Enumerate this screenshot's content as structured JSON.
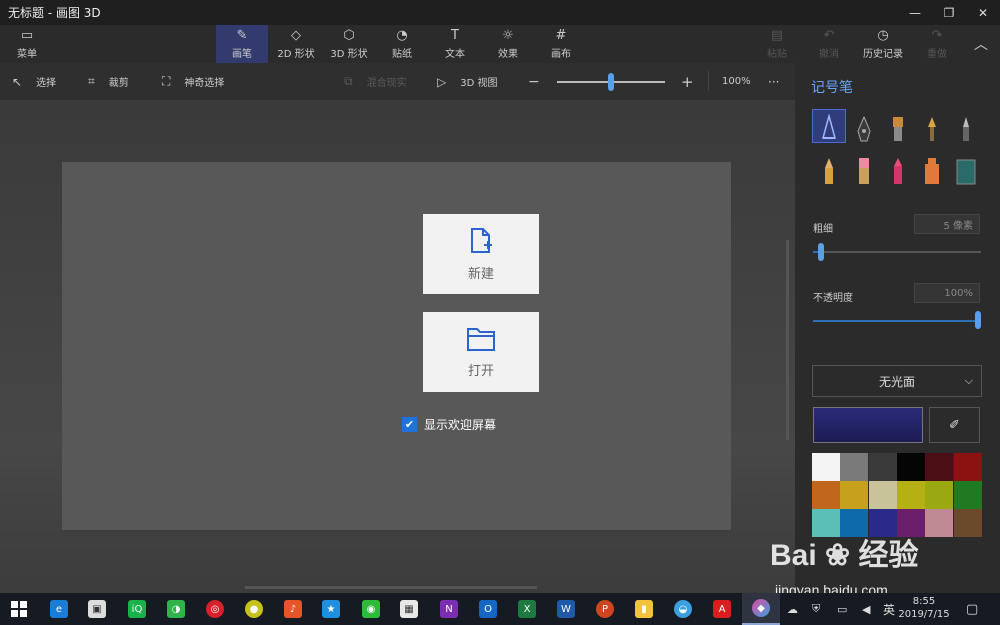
{
  "window": {
    "title": "无标题 - 画图 3D",
    "controls": [
      "—",
      "❐",
      "✕"
    ]
  },
  "ribbon": {
    "menu": "菜单",
    "tabs": [
      {
        "label": "画笔",
        "icon": "brush-icon",
        "glyph": "✎"
      },
      {
        "label": "2D 形状",
        "icon": "shapes-2d-icon",
        "glyph": "◇"
      },
      {
        "label": "3D 形状",
        "icon": "cube-icon",
        "glyph": "⬡"
      },
      {
        "label": "贴纸",
        "icon": "sticker-icon",
        "glyph": "◔"
      },
      {
        "label": "文本",
        "icon": "text-icon",
        "glyph": "T"
      },
      {
        "label": "效果",
        "icon": "effects-icon",
        "glyph": "☼"
      },
      {
        "label": "画布",
        "icon": "canvas-icon",
        "glyph": "#"
      }
    ],
    "right": [
      {
        "label": "粘贴",
        "icon": "paste-icon",
        "glyph": "▤"
      },
      {
        "label": "撤消",
        "icon": "undo-icon",
        "glyph": "↶"
      },
      {
        "label": "历史记录",
        "icon": "history-icon",
        "glyph": "◷"
      },
      {
        "label": "重做",
        "icon": "redo-icon",
        "glyph": "↷"
      }
    ]
  },
  "toolbar": {
    "select": "选择",
    "crop": "裁剪",
    "magic_select": "神奇选择",
    "mixed_reality": "混合现实",
    "view_3d": "3D 视图",
    "zoom": "100%",
    "zoom_level": 0.5,
    "more": "···"
  },
  "welcome": {
    "new_label": "新建",
    "open_label": "打开",
    "show_welcome": "显示欢迎屏幕",
    "checked": true
  },
  "panel": {
    "title": "记号笔",
    "thickness_label": "粗细",
    "thickness_value": "5 像素",
    "thickness_level": 0.05,
    "opacity_label": "不透明度",
    "opacity_value": "100%",
    "opacity_level": 1.0,
    "finish": "无光面",
    "current_color": "#2b2a7a",
    "swatches": [
      "#f4f4f4",
      "#7a7a7a",
      "#3a3a3a",
      "#050505",
      "#4a0e14",
      "#8c1212",
      "#c0671b",
      "#c7a11c",
      "#c9c39a",
      "#b5b014",
      "#9aa812",
      "#1f7a22",
      "#5bbfb5",
      "#0e6aa8",
      "#2a2a8a",
      "#6b1f6a",
      "#c08a94",
      "#6a4a2a"
    ]
  },
  "taskbar": {
    "apps": [
      "start",
      "edge",
      "store",
      "iqiyi",
      "wechat-work",
      "netease-music",
      "app-green",
      "music",
      "cloud-star",
      "wechat",
      "calculator",
      "onenote",
      "outlook",
      "excel",
      "word",
      "powerpoint",
      "files",
      "browser",
      "acrobat",
      "paint3d"
    ],
    "tray_lang": "英",
    "time": "8:55",
    "date": "2019/7/15"
  },
  "watermark": {
    "brand": "Bai",
    "brand2": "经验",
    "url": "jingyan.baidu.com"
  }
}
